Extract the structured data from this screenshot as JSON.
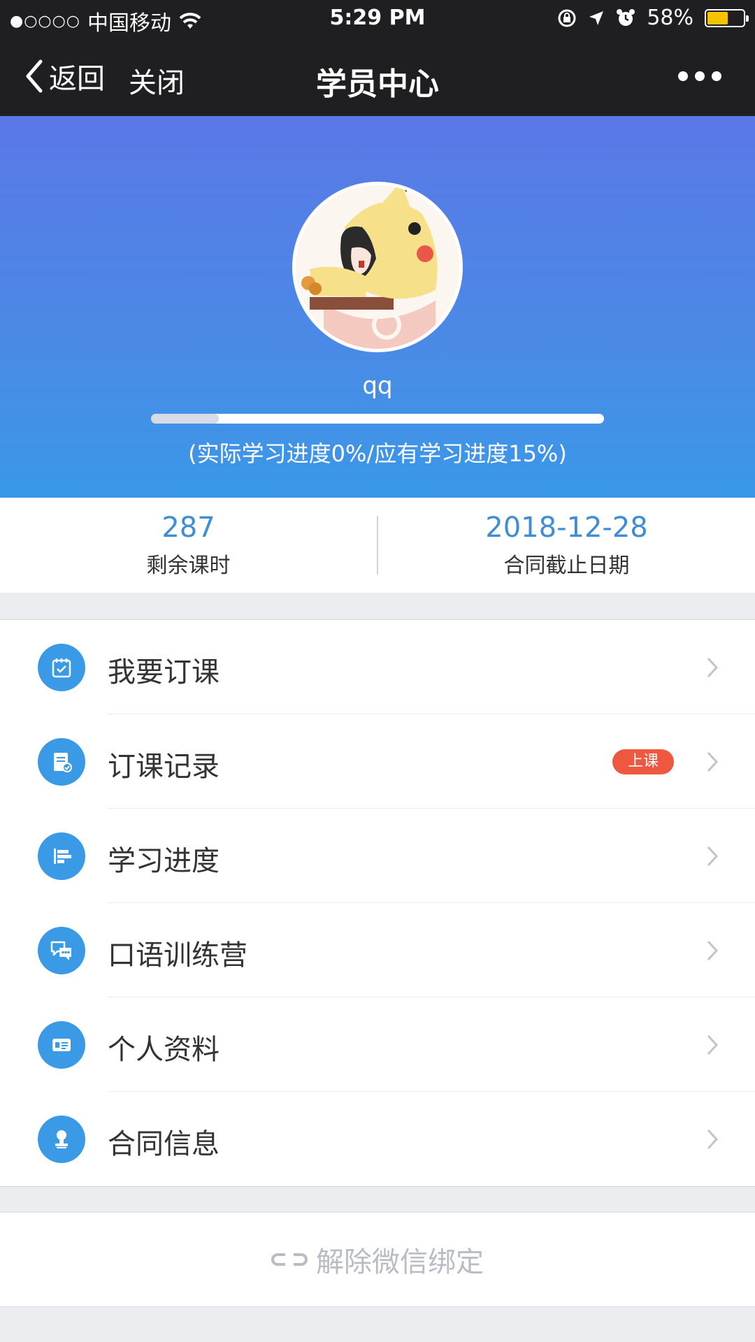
{
  "status_bar": {
    "carrier": "中国移动",
    "signal_dots": "●○○○○",
    "time": "5:29 PM",
    "battery_percent": "58%",
    "battery_level": 0.58,
    "battery_color": "#f5c400"
  },
  "nav": {
    "back_label": "返回",
    "close_label": "关闭",
    "title": "学员中心"
  },
  "profile": {
    "username": "qq",
    "progress_actual": 0.0,
    "progress_expected": 0.15,
    "progress_caption": "(实际学习进度0%/应有学习进度15%)"
  },
  "stats": [
    {
      "value": "287",
      "label": "剩余课时"
    },
    {
      "value": "2018-12-28",
      "label": "合同截止日期"
    }
  ],
  "menu": [
    {
      "label": "我要订课",
      "icon": "calendar-check-icon"
    },
    {
      "label": "订课记录",
      "icon": "document-check-icon",
      "badge": "上课"
    },
    {
      "label": "学习进度",
      "icon": "progress-bars-icon"
    },
    {
      "label": "口语训练营",
      "icon": "chat-bubbles-icon"
    },
    {
      "label": "个人资料",
      "icon": "id-card-icon"
    },
    {
      "label": "合同信息",
      "icon": "stamp-icon"
    }
  ],
  "unbind_label": "解除微信绑定",
  "colors": {
    "accent": "#3a9ae6",
    "hero_top": "#5a78e6",
    "hero_bottom": "#3a98e8",
    "badge": "#ee5740",
    "stat_value": "#3e8ed6"
  }
}
